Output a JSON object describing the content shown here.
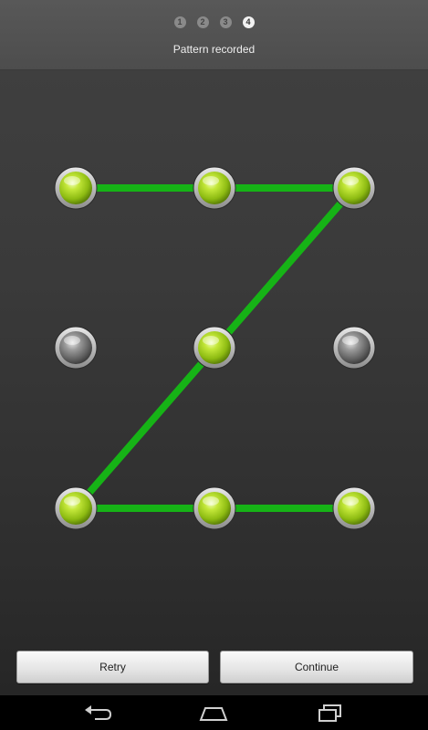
{
  "steps": [
    "1",
    "2",
    "3",
    "4"
  ],
  "active_step": "4",
  "status_text": "Pattern recorded",
  "buttons": {
    "retry": "Retry",
    "continue": "Continue"
  },
  "pattern": {
    "grid": "3x3",
    "selected_nodes": [
      1,
      2,
      3,
      5,
      7,
      8,
      9
    ],
    "sequence": [
      1,
      2,
      3,
      5,
      7,
      8,
      9
    ],
    "line_color": "#16b316",
    "selected_color": "#9ccc1e",
    "unselected_color": "#7a7a7a"
  },
  "navbar": {
    "icons": [
      "back-icon",
      "home-icon",
      "recent-apps-icon"
    ]
  }
}
